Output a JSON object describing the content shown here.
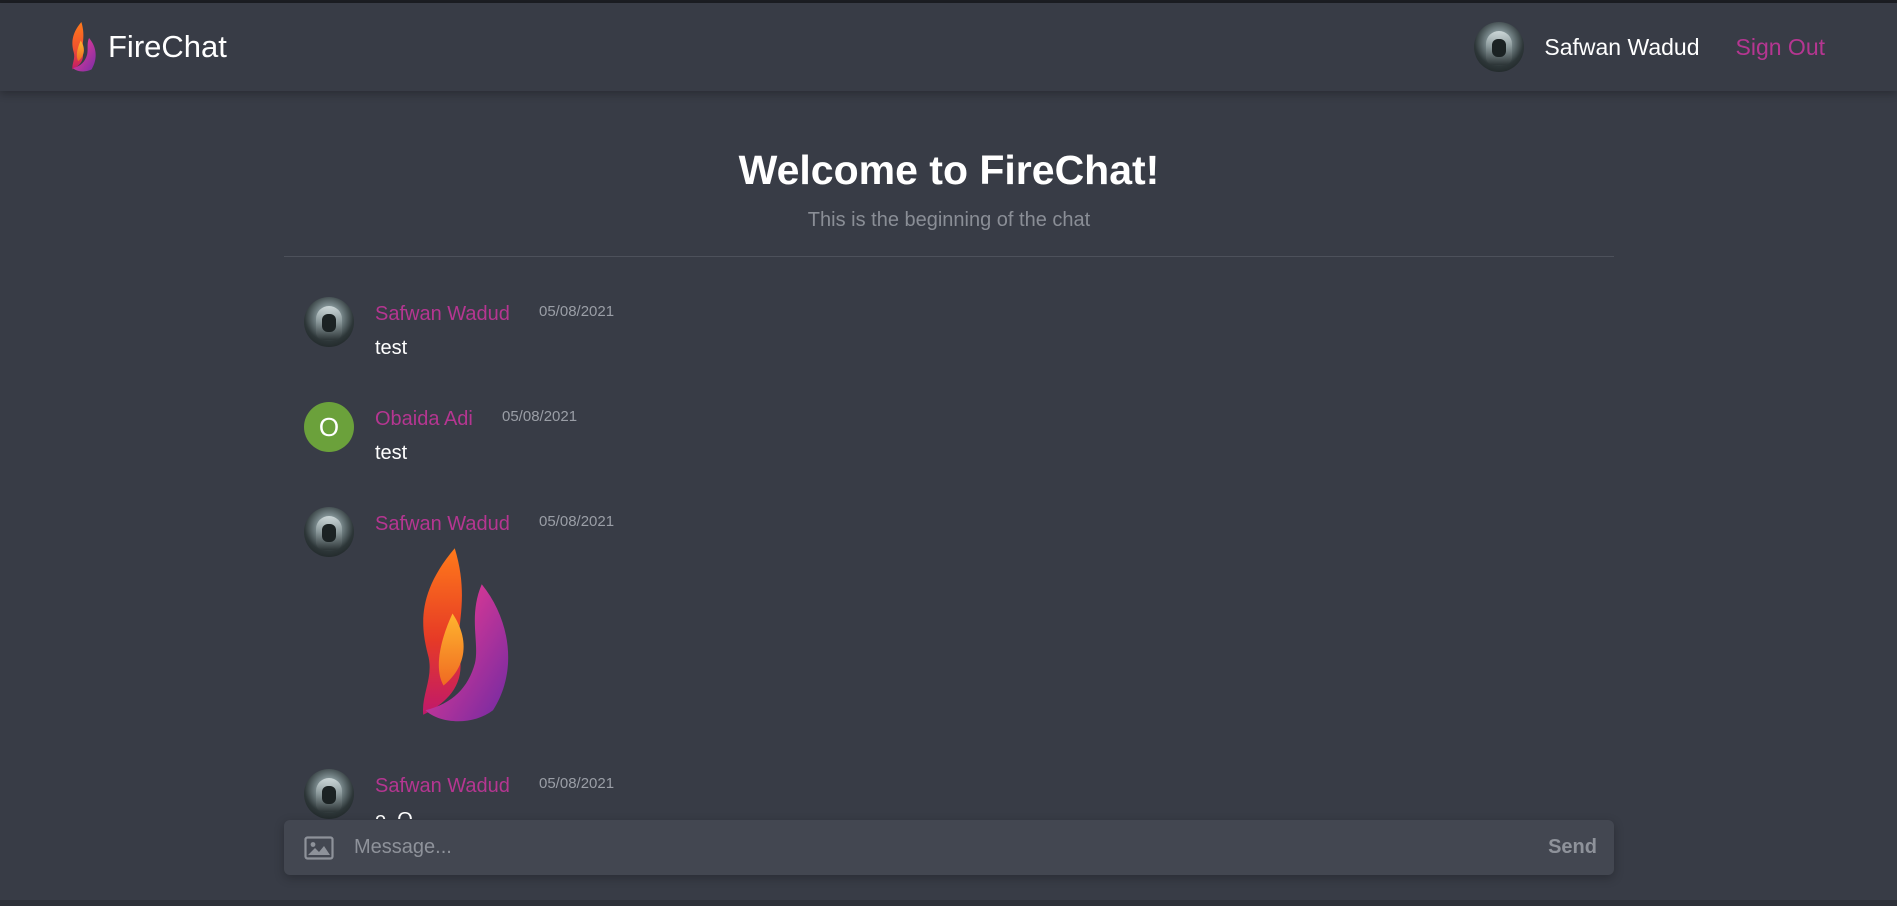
{
  "app": {
    "name": "FireChat"
  },
  "header": {
    "user_name": "Safwan Wadud",
    "sign_out_label": "Sign Out"
  },
  "welcome": {
    "title": "Welcome to FireChat!",
    "subtitle": "This is the beginning of the chat"
  },
  "messages": [
    {
      "author": "Safwan Wadud",
      "date": "05/08/2021",
      "text": "test",
      "avatar": "photo"
    },
    {
      "author": "Obaida Adi",
      "date": "05/08/2021",
      "text": "test",
      "avatar": "letter",
      "avatar_letter": "O",
      "avatar_color": "#6ba13b"
    },
    {
      "author": "Safwan Wadud",
      "date": "05/08/2021",
      "image": "firechat-logo-image",
      "avatar": "photo"
    },
    {
      "author": "Safwan Wadud",
      "date": "05/08/2021",
      "text": "o_O",
      "avatar": "photo"
    }
  ],
  "composer": {
    "placeholder": "Message...",
    "send_label": "Send",
    "image_icon": "image-icon"
  },
  "colors": {
    "background": "#383c46",
    "accent": "#b53691",
    "composer_bg": "#434751"
  }
}
